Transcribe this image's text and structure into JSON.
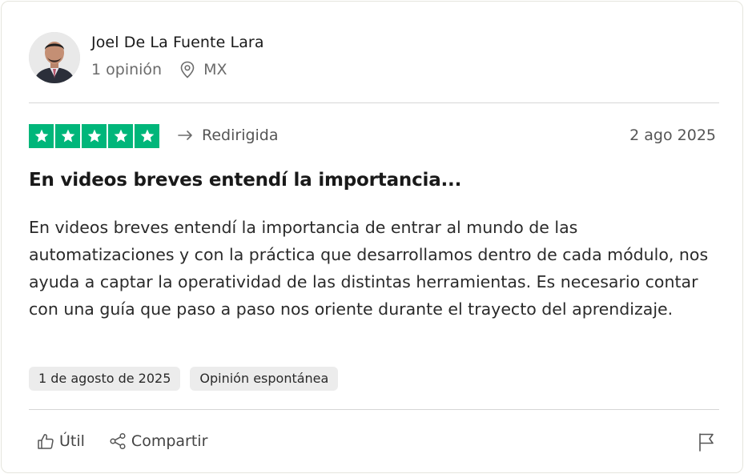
{
  "reviewer": {
    "name": "Joel De La Fuente Lara",
    "review_count": "1 opinión",
    "country": "MX"
  },
  "review": {
    "rating": 5,
    "rating_max": 5,
    "source_label": "Redirigida",
    "date": "2 ago 2025",
    "title": "En videos breves entendí la importancia...",
    "body": "En videos breves entendí la importancia de entrar al mundo de las automatizaciones y con la práctica que desarrollamos dentro de cada módulo, nos ayuda a captar la operatividad de las distintas herramientas. Es necesario contar con una guía que paso a paso nos oriente durante el trayecto del aprendizaje.",
    "tags": [
      "1 de agosto de 2025",
      "Opinión espontánea"
    ]
  },
  "actions": {
    "useful_label": "Útil",
    "share_label": "Compartir"
  },
  "colors": {
    "star_green": "#00b67a",
    "tag_bg": "#ececec",
    "divider": "#d6d6d6"
  },
  "icons": {
    "location": "map-pin-icon",
    "redirect": "redirect-arrow-icon",
    "useful": "thumbs-up-icon",
    "share": "share-icon",
    "report": "flag-icon"
  }
}
